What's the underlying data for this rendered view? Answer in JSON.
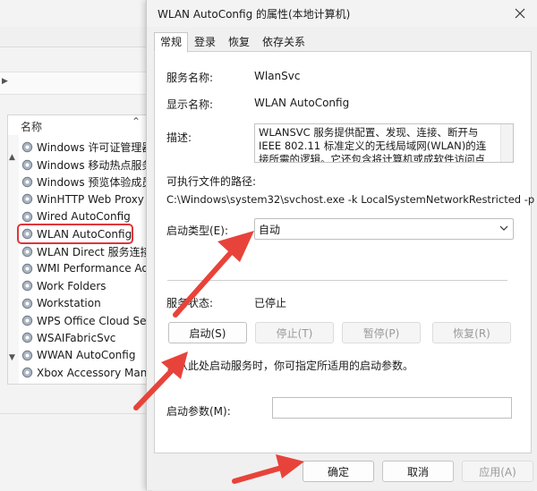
{
  "background_window": {
    "list_header": "名称",
    "services": [
      "Windows 许可证管理器服",
      "Windows 移动热点服务",
      "Windows 预览体验成员服",
      "WinHTTP Web Proxy Au",
      "Wired AutoConfig",
      "WLAN AutoConfig",
      "WLAN Direct 服务连接管",
      "WMI Performance Ada",
      "Work Folders",
      "Workstation",
      "WPS Office Cloud Servi",
      "WSAIFabricSvc",
      "WWAN AutoConfig",
      "Xbox Accessory Manag"
    ],
    "selected_service": "WLAN AutoConfig"
  },
  "dialog": {
    "title": "WLAN AutoConfig 的属性(本地计算机)",
    "tabs": [
      "常规",
      "登录",
      "恢复",
      "依存关系"
    ],
    "active_tab": "常规",
    "service_name_label": "服务名称:",
    "service_name": "WlanSvc",
    "display_name_label": "显示名称:",
    "display_name": "WLAN AutoConfig",
    "description_label": "描述:",
    "description": "WLANSVC 服务提供配置、发现、连接、断开与 IEEE 802.11 标准定义的无线局域网(WLAN)的连接所需的逻辑。它还包含将计算机或成软件访问点的逻辑，以便",
    "exe_path_label": "可执行文件的路径:",
    "exe_path": "C:\\Windows\\system32\\svchost.exe -k LocalSystemNetworkRestricted -p",
    "startup_type_label": "启动类型(E):",
    "startup_type": "自动",
    "status_label": "服务状态:",
    "status": "已停止",
    "buttons": {
      "start": "启动(S)",
      "stop": "停止(T)",
      "pause": "暂停(P)",
      "resume": "恢复(R)"
    },
    "hint": "当从此处启动服务时，你可指定所适用的启动参数。",
    "start_params_label": "启动参数(M):",
    "start_params_value": "",
    "ok": "确定",
    "cancel": "取消",
    "apply": "应用(A)"
  },
  "colors": {
    "highlight_box": "#e0353a",
    "annotation_arrow": "#e8433a"
  }
}
